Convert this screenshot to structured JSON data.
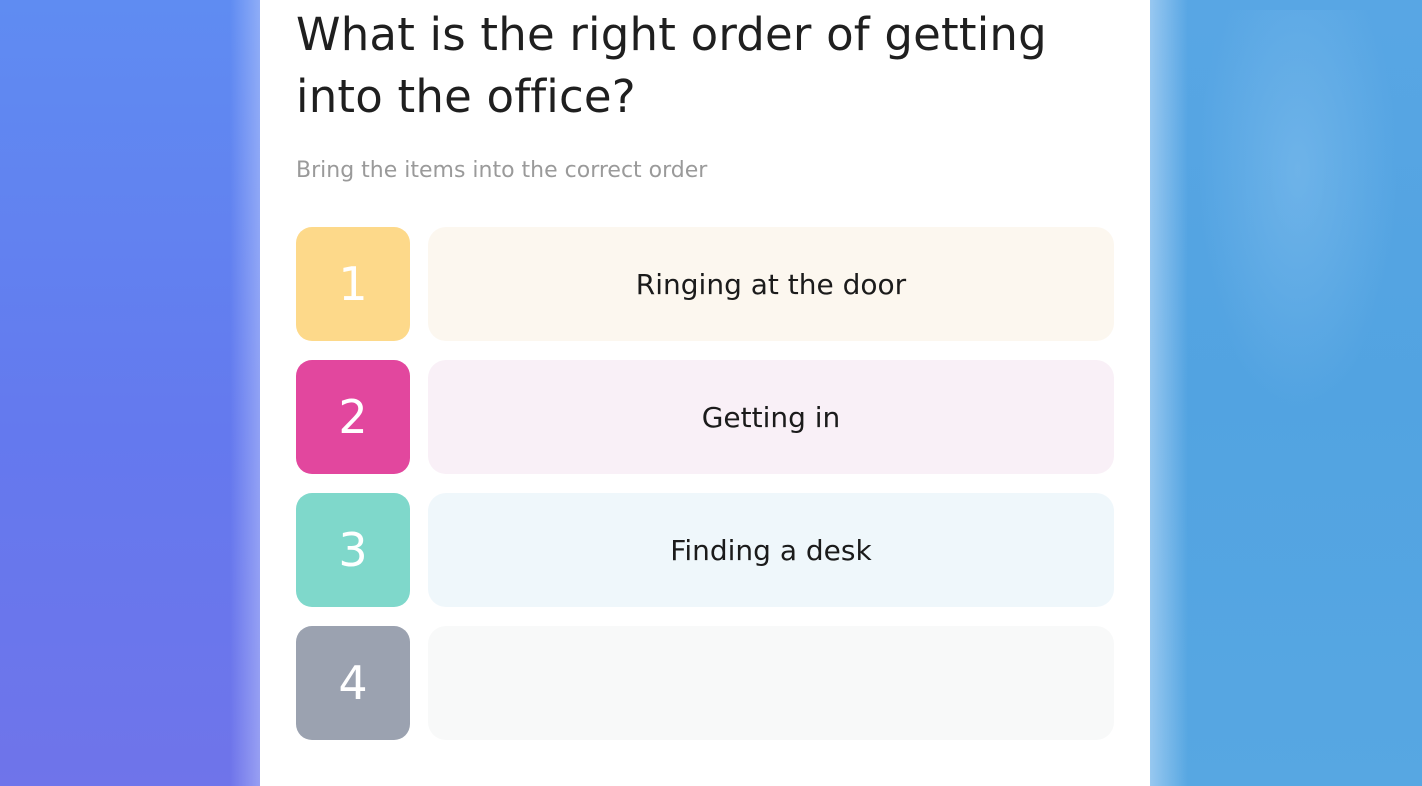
{
  "question": "What is the right order of getting into the office?",
  "instruction": "Bring the items into the correct order",
  "items": [
    {
      "number": "1",
      "label": "Ringing at the door",
      "number_color": "#fdd98a",
      "slot_color": "#fcf7ef"
    },
    {
      "number": "2",
      "label": "Getting in",
      "number_color": "#e2479e",
      "slot_color": "#f9f0f7"
    },
    {
      "number": "3",
      "label": "Finding a desk",
      "number_color": "#7fd8cb",
      "slot_color": "#eff7fb"
    },
    {
      "number": "4",
      "label": "",
      "number_color": "#9ba2b0",
      "slot_color": "#f8f9f9"
    }
  ]
}
